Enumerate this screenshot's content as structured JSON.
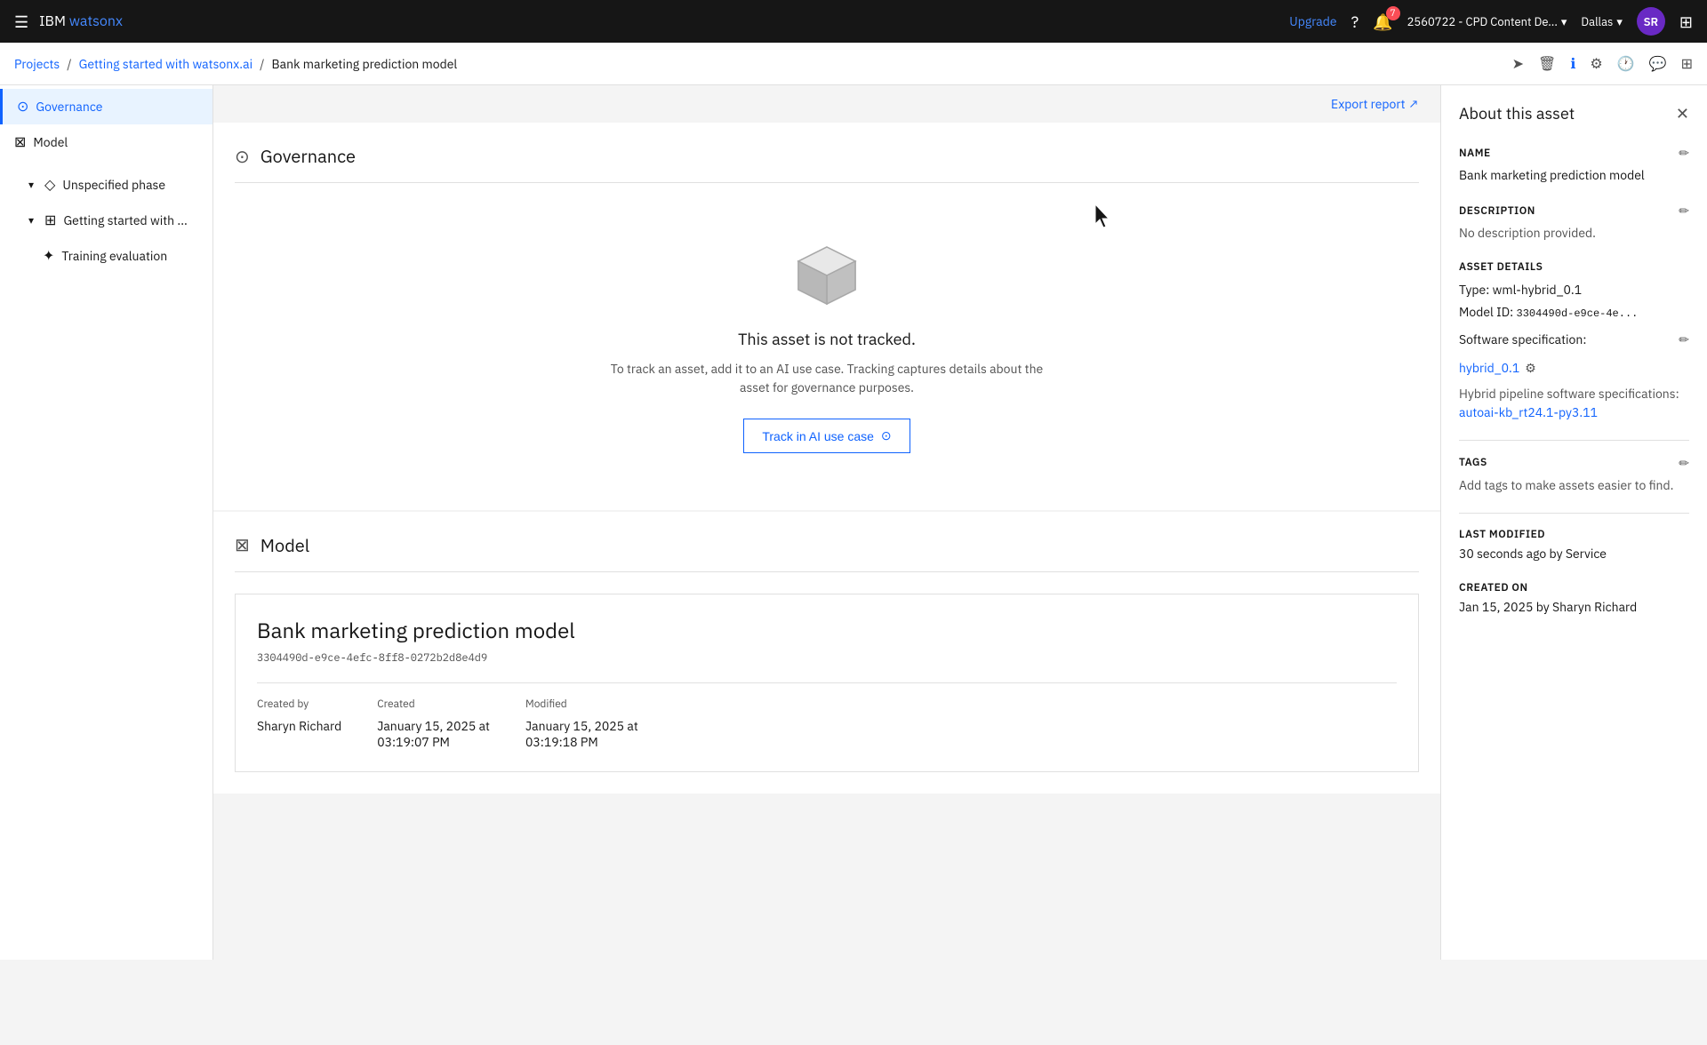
{
  "topnav": {
    "hamburger_icon": "☰",
    "app_prefix": "IBM ",
    "app_name": "watsonx",
    "upgrade_label": "Upgrade",
    "help_icon": "?",
    "notifications_count": "7",
    "account": "2560722 - CPD Content De...",
    "region": "Dallas",
    "avatar_initials": "SR",
    "grid_icon": "⊞"
  },
  "breadcrumb": {
    "projects": "Projects",
    "sep1": "/",
    "getting_started": "Getting started with watsonx.ai",
    "sep2": "/",
    "current": "Bank marketing prediction model"
  },
  "sidebar": {
    "governance_label": "Governance",
    "model_label": "Model",
    "unspecified_phase_label": "Unspecified phase",
    "getting_started_label": "Getting started with ...",
    "training_evaluation_label": "Training evaluation"
  },
  "governance_section": {
    "title": "Governance",
    "export_label": "Export report",
    "not_tracked_title": "This asset is not tracked.",
    "not_tracked_desc": "To track an asset, add it to an AI use case. Tracking captures details about the asset for governance purposes.",
    "track_button_label": "Track in AI use case"
  },
  "model_section": {
    "title": "Model",
    "model_name": "Bank marketing prediction model",
    "model_id": "3304490d-e9ce-4efc-8ff8-0272b2d8e4d9",
    "created_by_label": "Created by",
    "created_by_value": "Sharyn Richard",
    "created_label": "Created",
    "created_value": "January 15, 2025 at",
    "created_time": "03:19:07 PM",
    "modified_label": "Modified",
    "modified_value": "January 15, 2025 at",
    "modified_time": "03:19:18 PM"
  },
  "right_panel": {
    "title": "About this asset",
    "name_label": "Name",
    "name_value": "Bank marketing prediction model",
    "description_label": "Description",
    "description_value": "No description provided.",
    "asset_details_label": "Asset Details",
    "type_label": "Type:",
    "type_value": "wml-hybrid_0.1",
    "model_id_label": "Model ID:",
    "model_id_value": "3304490d-e9ce-4e...",
    "software_spec_label": "Software specification:",
    "software_spec_value": "hybrid_0.1",
    "hybrid_pipeline_label": "Hybrid pipeline software specifications:",
    "hybrid_pipeline_value": "autoai-kb_rt24.1-py3.11",
    "tags_label": "Tags",
    "tags_desc": "Add tags to make assets easier to find.",
    "last_modified_label": "Last modified",
    "last_modified_value": "30 seconds ago by Service",
    "created_on_label": "Created on",
    "created_on_value": "Jan 15, 2025 by Sharyn Richard"
  }
}
